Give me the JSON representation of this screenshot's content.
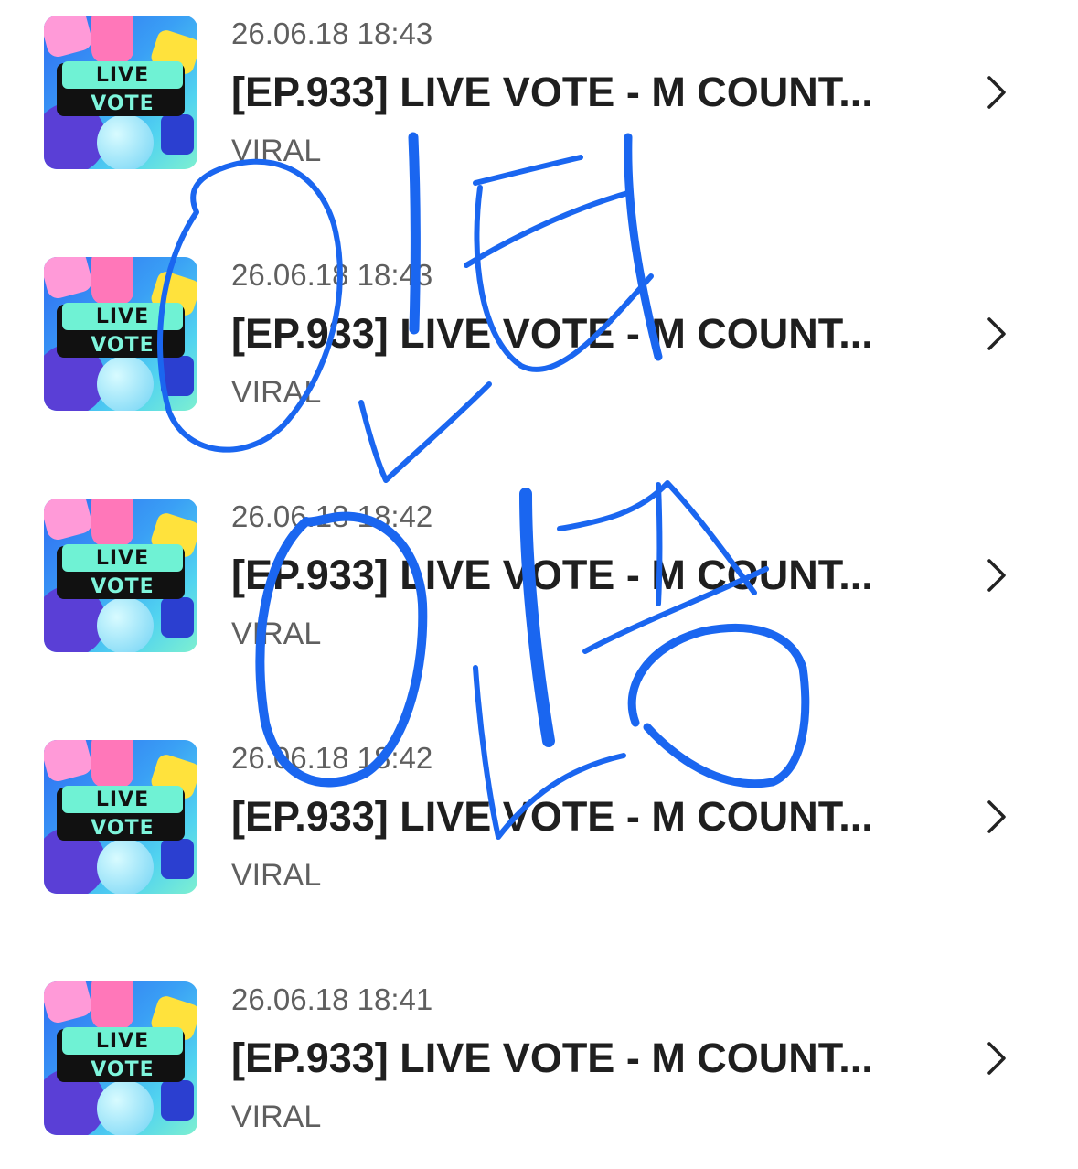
{
  "items": [
    {
      "timestamp": "26.06.18 18:43",
      "title": "[EP.933] LIVE VOTE - M COUNT...",
      "category": "VIRAL",
      "thumb_line1": "LIVE",
      "thumb_line2": "VOTE"
    },
    {
      "timestamp": "26.06.18 18:43",
      "title": "[EP.933] LIVE VOTE - M COUNT...",
      "category": "VIRAL",
      "thumb_line1": "LIVE",
      "thumb_line2": "VOTE"
    },
    {
      "timestamp": "26.06.18 18:42",
      "title": "[EP.933] LIVE VOTE - M COUNT...",
      "category": "VIRAL",
      "thumb_line1": "LIVE",
      "thumb_line2": "VOTE"
    },
    {
      "timestamp": "26.06.18 18:42",
      "title": "[EP.933] LIVE VOTE - M COUNT...",
      "category": "VIRAL",
      "thumb_line1": "LIVE",
      "thumb_line2": "VOTE"
    },
    {
      "timestamp": "26.06.18 18:41",
      "title": "[EP.933] LIVE VOTE - M COUNT...",
      "category": "VIRAL",
      "thumb_line1": "LIVE",
      "thumb_line2": "VOTE"
    }
  ],
  "colors": {
    "annotation_stroke": "#1a66f0",
    "text_primary": "#1f1f1f",
    "text_secondary": "#5f5f5f"
  },
  "icons": {
    "row_action": "chevron-right-icon"
  }
}
